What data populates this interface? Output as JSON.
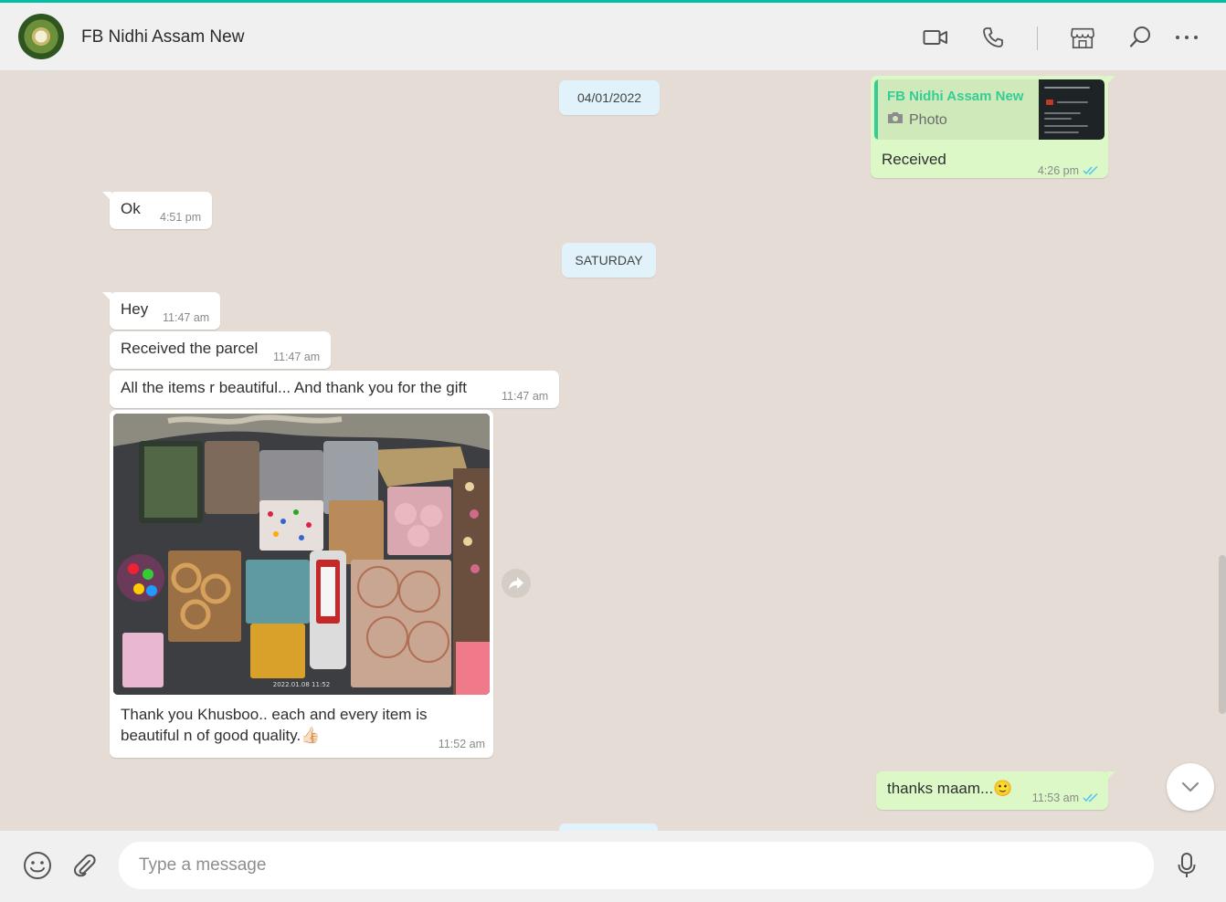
{
  "header": {
    "contact_name": "FB Nidhi Assam New"
  },
  "icons": {
    "video_call": "video-camera-icon",
    "voice_call": "phone-icon",
    "catalog": "store-icon",
    "search": "search-icon",
    "menu": "more-dots-icon",
    "emoji": "emoji-icon",
    "attach": "paperclip-icon",
    "mic": "microphone-icon",
    "forward": "forward-arrow-icon",
    "scroll_down": "chevron-down-icon",
    "read_receipt": "double-check-icon"
  },
  "colors": {
    "accent": "#00bfa5",
    "outgoing_bubble": "#dcf8c6",
    "incoming_bubble": "#ffffff",
    "read_ticks": "#4fc3f7",
    "chat_background": "#e5ddd5"
  },
  "chat": {
    "date_chips": [
      "04/01/2022",
      "SATURDAY"
    ],
    "messages": [
      {
        "direction": "out",
        "quote_name": "FB Nidhi Assam New",
        "quote_type": "Photo",
        "text": "Received",
        "time": "4:26 pm"
      },
      {
        "direction": "in",
        "text": "Ok",
        "time": "4:51 pm"
      },
      {
        "direction": "in",
        "text": "Hey",
        "time": "11:47 am"
      },
      {
        "direction": "in",
        "text": "Received the parcel",
        "time": "11:47 am"
      },
      {
        "direction": "in",
        "text": "All the items r beautiful... And thank you for the gift",
        "time": "11:47 am"
      },
      {
        "direction": "in",
        "photo_stamp": "2022.01.08 11:52",
        "text": "Thank you Khusboo.. each and every item is beautiful n of good quality.👍🏻",
        "time": "11:52 am"
      },
      {
        "direction": "out",
        "text": "thanks maam...🙂",
        "time": "11:53 am"
      }
    ]
  },
  "composer": {
    "placeholder": "Type a message"
  }
}
